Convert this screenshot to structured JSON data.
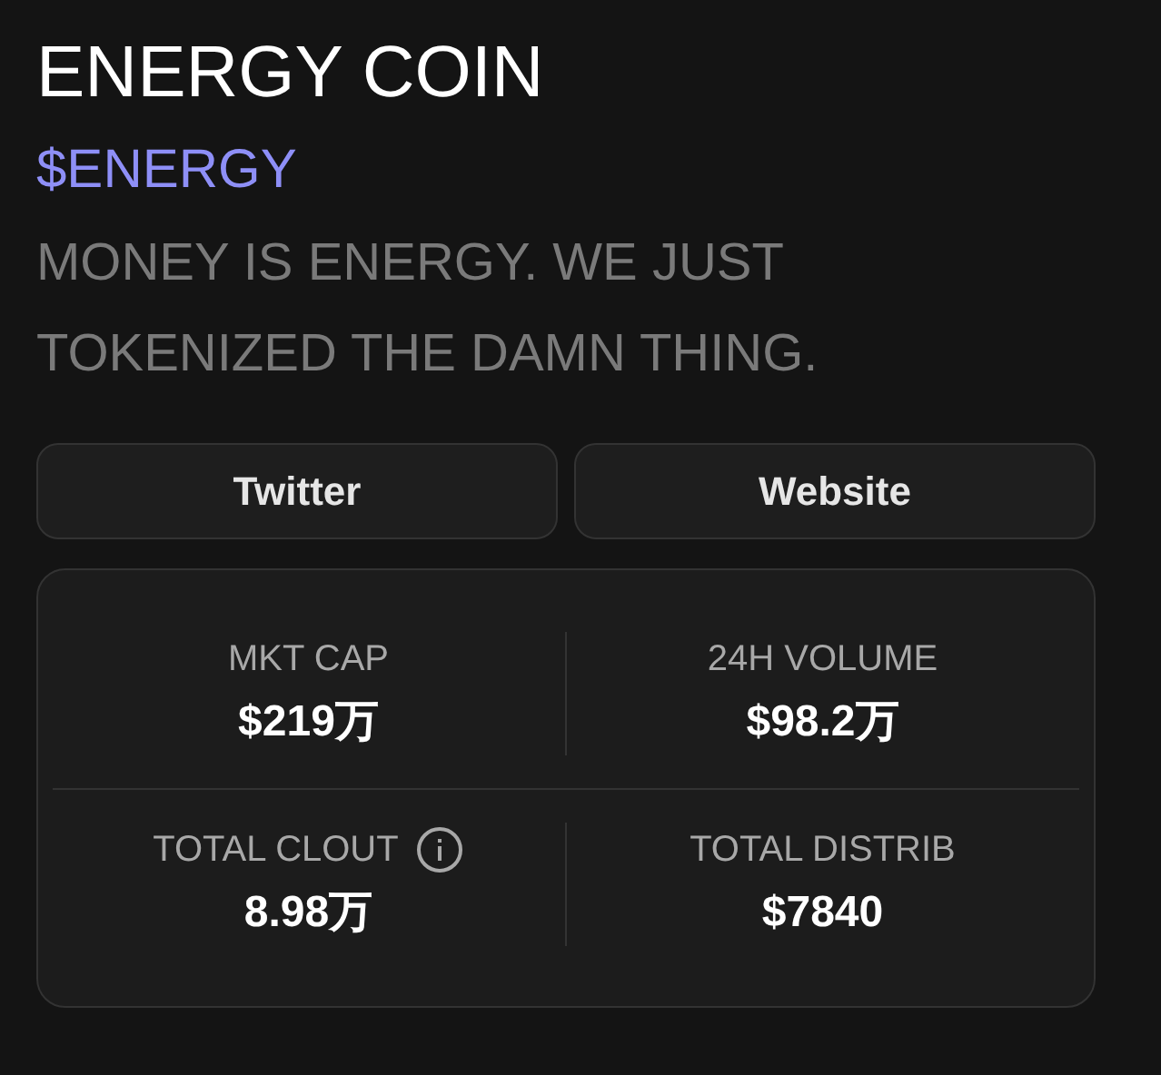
{
  "title": "ENERGY COIN",
  "ticker": "$ENERGY",
  "description": "MONEY IS ENERGY. WE JUST TOKENIZED THE DAMN THING.",
  "links": [
    {
      "label": "Twitter"
    },
    {
      "label": "Website"
    }
  ],
  "stats": [
    {
      "label": "MKT CAP",
      "value": "$219万",
      "info": false
    },
    {
      "label": "24H VOLUME",
      "value": "$98.2万",
      "info": false
    },
    {
      "label": "TOTAL CLOUT",
      "value": "8.98万",
      "info": true
    },
    {
      "label": "TOTAL DISTRIB",
      "value": "$7840",
      "info": false
    }
  ]
}
